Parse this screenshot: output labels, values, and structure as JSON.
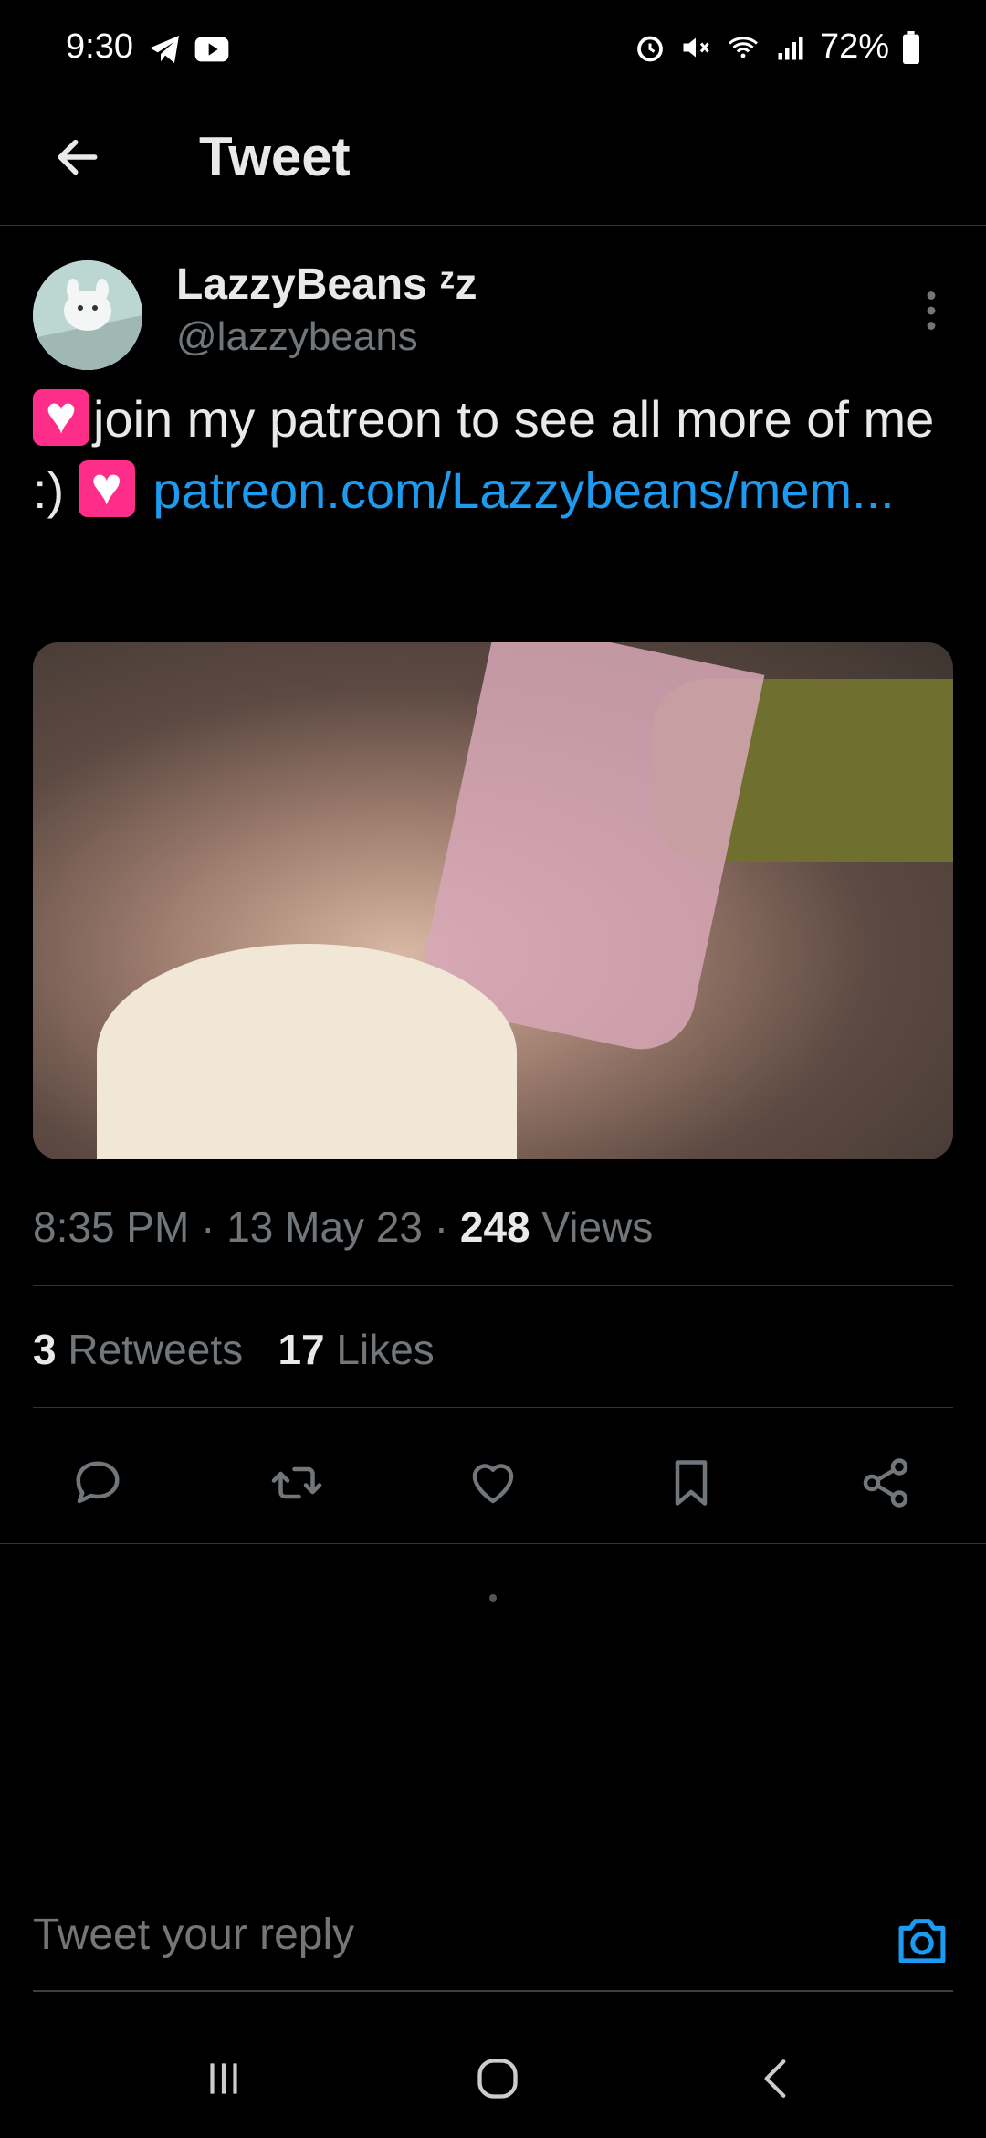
{
  "status_bar": {
    "time": "9:30",
    "battery_percent": "72%",
    "icons": [
      "telegram-icon",
      "youtube-icon",
      "alarm-icon",
      "mute-icon",
      "wifi-icon",
      "signal-icon",
      "battery-icon"
    ]
  },
  "header": {
    "title": "Tweet"
  },
  "tweet": {
    "author_name": "LazzyBeans ᶻz",
    "author_handle": "@lazzybeans",
    "text_part1": "join my patreon to see all more of me :) ",
    "link_text": "patreon.com/Lazzybeans/mem...",
    "meta": {
      "time": "8:35 PM",
      "separator": "·",
      "date": "13 May 23",
      "views_count": "248",
      "views_label": "Views"
    },
    "stats": {
      "retweets_count": "3",
      "retweets_label": "Retweets",
      "likes_count": "17",
      "likes_label": "Likes"
    }
  },
  "reply": {
    "placeholder": "Tweet your reply"
  },
  "colors": {
    "background": "#000000",
    "accent": "#1d9bf0",
    "secondary_text": "#71767b",
    "divider": "#2f3336"
  }
}
